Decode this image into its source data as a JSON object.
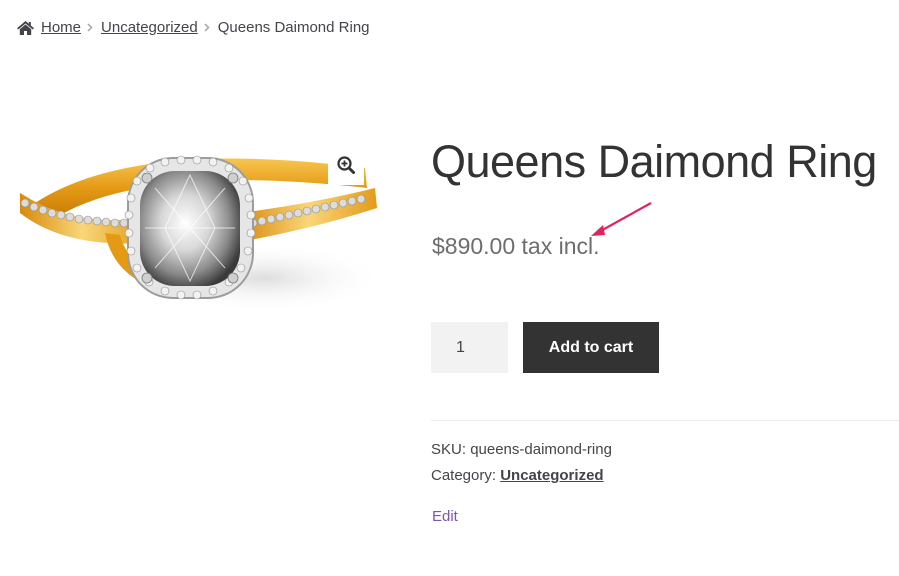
{
  "breadcrumb": {
    "home_icon": "home-icon",
    "home": "Home",
    "category": "Uncategorized",
    "current": "Queens Daimond Ring"
  },
  "product": {
    "image_alt": "Gold diamond ring",
    "zoom_icon": "zoom-in-icon",
    "title": "Queens Daimond Ring",
    "price": "$890.00 tax incl.",
    "quantity": "1",
    "add_to_cart_label": "Add to cart",
    "sku_label": "SKU:",
    "sku_value": "queens-daimond-ring",
    "category_label": "Category:",
    "category_value": "Uncategorized",
    "edit_label": "Edit"
  },
  "colors": {
    "button_bg": "#333333",
    "link_purple": "#7f54b3",
    "annotation_arrow": "#e0245e",
    "qty_bg": "#f2f2f2"
  }
}
